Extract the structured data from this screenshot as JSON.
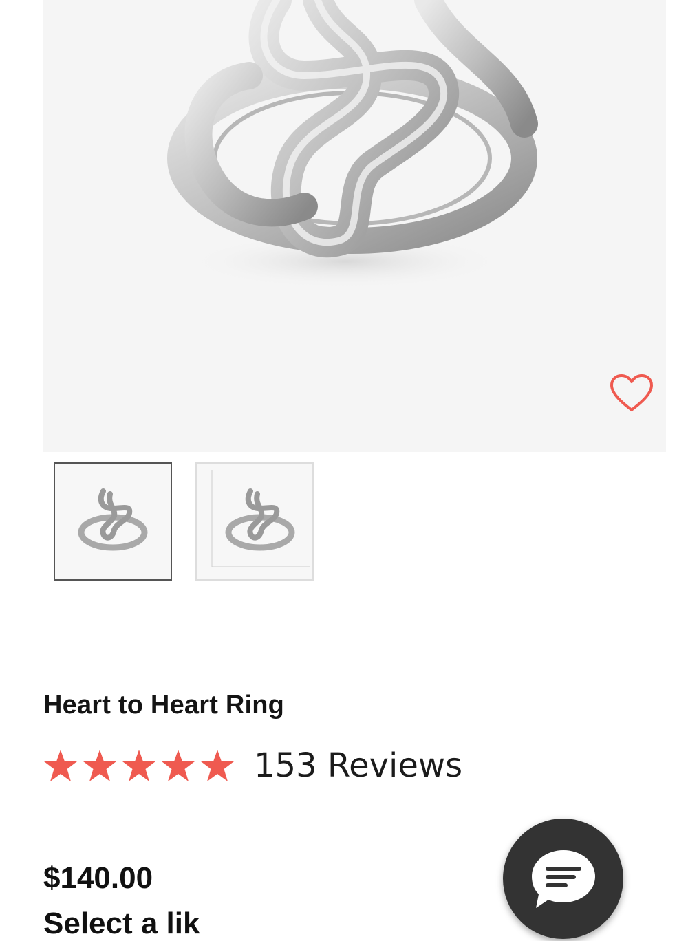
{
  "product": {
    "title": "Heart to Heart Ring",
    "rating_stars": 5,
    "reviews_label": "153 Reviews",
    "price": "$140.00",
    "cutoff_text": "Select a lik"
  },
  "icons": {
    "wishlist": "heart-outline-icon",
    "chat": "chat-bubble-icon",
    "star": "star-icon"
  },
  "colors": {
    "accent": "#ef5a50",
    "hero_bg": "#f5f5f5",
    "chat_bg": "#333333",
    "text": "#111111"
  }
}
